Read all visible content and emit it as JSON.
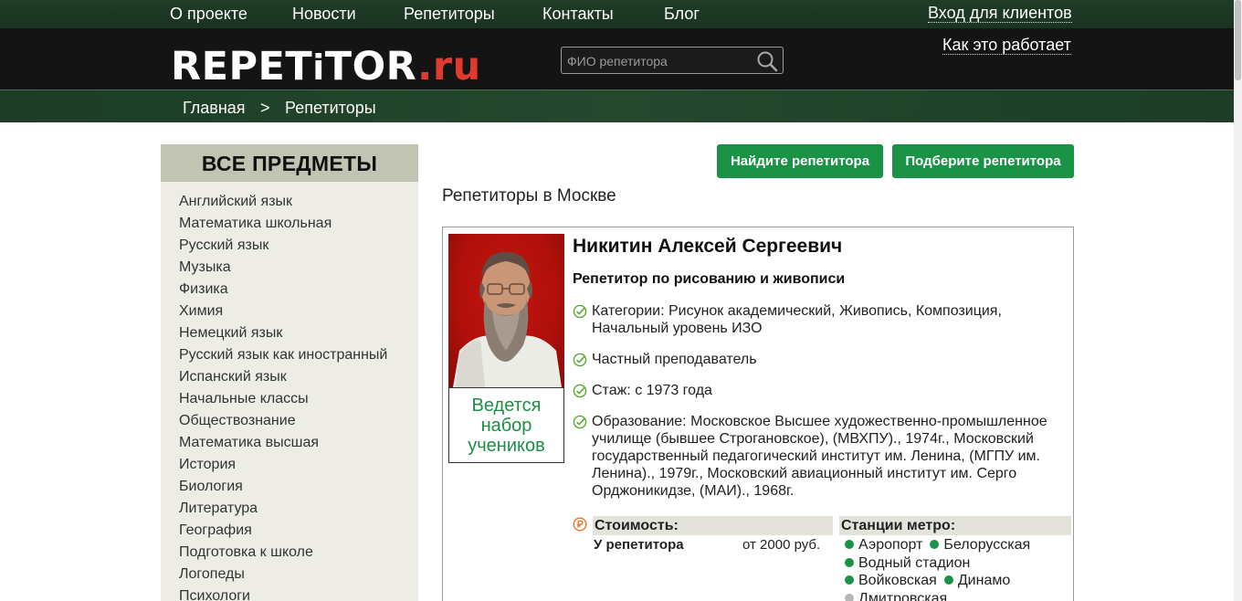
{
  "topnav": {
    "items": [
      "О проекте",
      "Новости",
      "Репетиторы",
      "Контакты",
      "Блог"
    ],
    "login": "Вход для клиентов"
  },
  "header": {
    "logo_main": "REPET",
    "logo_i": "i",
    "logo_mid": "TOR",
    "logo_dot": ".",
    "logo_ru": "ru",
    "search_placeholder": "ФИО репетитора",
    "how_it_works": "Как это работает"
  },
  "breadcrumb": {
    "home": "Главная",
    "separator": ">",
    "current": "Репетиторы"
  },
  "sidebar": {
    "title": "ВСЕ ПРЕДМЕТЫ",
    "items": [
      "Английский язык",
      "Математика школьная",
      "Русский язык",
      "Музыка",
      "Физика",
      "Химия",
      "Немецкий язык",
      "Русский язык как иностранный",
      "Испанский язык",
      "Начальные классы",
      "Обществознание",
      "Математика высшая",
      "История",
      "Биология",
      "Литература",
      "География",
      "Подготовка к школе",
      "Логопеды",
      "Психологи"
    ]
  },
  "buttons": {
    "find": "Найдите репетитора",
    "pick": "Подберите репетитора"
  },
  "page_title": "Репетиторы в Москве",
  "tutor": {
    "name": "Никитин Алексей Сергеевич",
    "subtitle": "Репетитор по рисованию и живописи",
    "status": "Ведется набор учеников",
    "facts": [
      "Категории: Рисунок академический, Живопись, Композиция, Начальный уровень ИЗО",
      "Частный преподаватель",
      "Стаж: с 1973 года",
      "Образование: Московское Высшее художественно-промышленное училище (бывшее Строгановское), (МВХПУ)., 1974г., Московский государственный педагогический институт им. Ленина, (МГПУ им. Ленина)., 1979г., Московский авиационный институт им. Серго Орджоникидзе, (МАИ)., 1968г."
    ],
    "price_heading": "Стоимость:",
    "price_label": "У репетитора",
    "price_value": "от 2000 руб.",
    "metro_heading": "Станции метро:",
    "metro": [
      {
        "name": "Аэропорт",
        "color": "#1b9346"
      },
      {
        "name": "Белорусская",
        "color": "#1b9346"
      },
      {
        "name": "Водный стадион",
        "color": "#1b9346"
      },
      {
        "name": "Войковская",
        "color": "#1b9346"
      },
      {
        "name": "Динамо",
        "color": "#1b9346"
      },
      {
        "name": "Дмитровская",
        "color": "#b7b7b7"
      }
    ]
  },
  "colors": {
    "accent_green": "#1b9346",
    "logo_red": "#e03a2e",
    "header_dark": "#141414",
    "nav_green": "#1f3d27"
  }
}
